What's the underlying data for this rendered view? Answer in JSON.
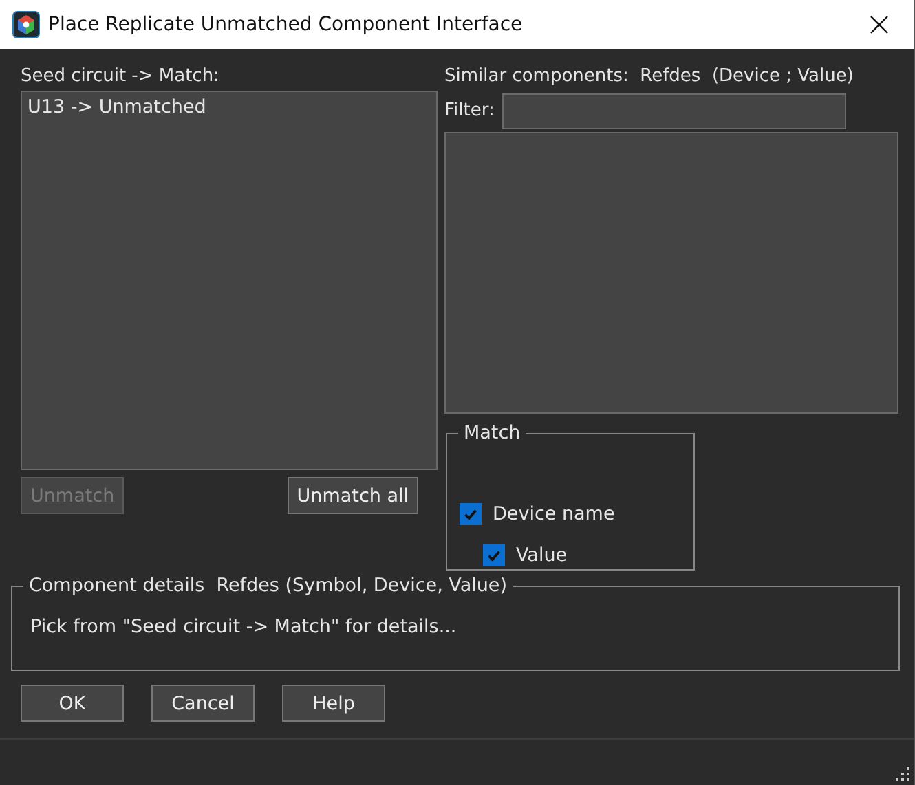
{
  "window": {
    "title": "Place Replicate Unmatched Component Interface"
  },
  "seed": {
    "label": "Seed circuit -> Match:",
    "items": [
      "U13 -> Unmatched"
    ]
  },
  "seed_buttons": [
    {
      "label": "Unmatch",
      "disabled": true
    },
    {
      "label": "Unmatch all",
      "disabled": false
    }
  ],
  "similar": {
    "label": "Similar components:  Refdes  (Device ; Value)",
    "filter_label": "Filter:"
  },
  "match": {
    "title": "Match",
    "options": [
      {
        "label": "Device name",
        "checked": true,
        "children": [
          {
            "label": "Value",
            "checked": true
          }
        ]
      }
    ]
  },
  "details": {
    "title": "Component details  Refdes (Symbol, Device, Value)",
    "text": "Pick from \"Seed circuit -> Match\" for details..."
  },
  "buttons": [
    {
      "label": "OK",
      "disabled": false
    },
    {
      "label": "Cancel",
      "disabled": false
    },
    {
      "label": "Help",
      "disabled": false
    }
  ]
}
